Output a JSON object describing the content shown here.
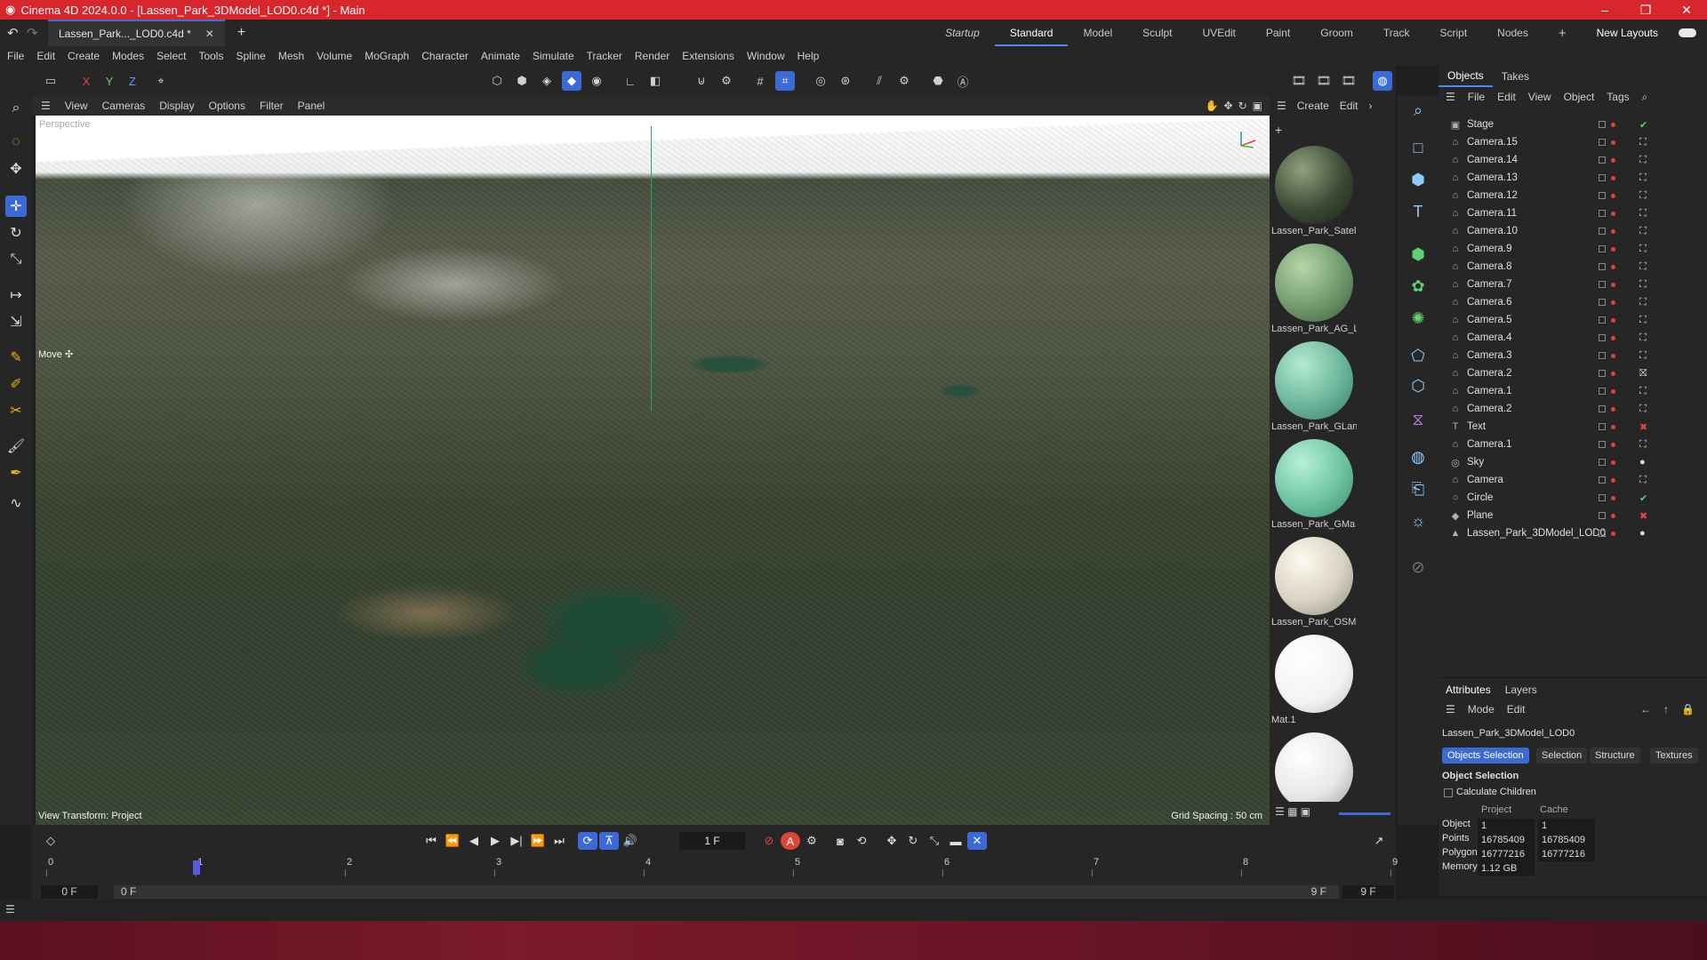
{
  "window": {
    "title": "Cinema 4D 2024.0.0 - [Lassen_Park_3DModel_LOD0.c4d *] - Main",
    "accent_color": "#d8262d"
  },
  "doc_tab": {
    "label": "Lassen_Park..._LOD0.c4d *"
  },
  "layouts": [
    "Startup",
    "Standard",
    "Model",
    "Sculpt",
    "UVEdit",
    "Paint",
    "Groom",
    "Track",
    "Script",
    "Nodes"
  ],
  "layouts_active": "Standard",
  "new_layouts": "New Layouts",
  "menu": [
    "File",
    "Edit",
    "Create",
    "Modes",
    "Select",
    "Tools",
    "Spline",
    "Mesh",
    "Volume",
    "MoGraph",
    "Character",
    "Animate",
    "Simulate",
    "Tracker",
    "Render",
    "Extensions",
    "Window",
    "Help"
  ],
  "toolbar": {
    "x": "X",
    "y": "Y",
    "z": "Z"
  },
  "viewport": {
    "menu": [
      "View",
      "Cameras",
      "Display",
      "Options",
      "Filter",
      "Panel"
    ],
    "camera_label": "Perspective",
    "move_label": "Move ✣",
    "view_transform": "View Transform: Project",
    "grid_spacing": "Grid Spacing : 50 cm"
  },
  "materials": {
    "menu": [
      "Create",
      "Edit"
    ],
    "items": [
      {
        "label": "Lassen_Park_Satel",
        "color": "#3b4a35"
      },
      {
        "label": "Lassen_Park_AG_L",
        "color": "#6f9a6c"
      },
      {
        "label": "Lassen_Park_GLan",
        "color": "#6ab69a"
      },
      {
        "label": "Lassen_Park_GMa",
        "color": "#6cc4a2"
      },
      {
        "label": "Lassen_Park_OSM",
        "color": "#d8d2c2"
      },
      {
        "label": "Mat.1",
        "color": "#f2f2f2"
      },
      {
        "label": "",
        "color": "#e8e8e8"
      }
    ]
  },
  "objects": {
    "tabs": [
      "Objects",
      "Takes"
    ],
    "menu": [
      "File",
      "Edit",
      "View",
      "Object",
      "Tags"
    ],
    "items": [
      {
        "name": "Stage",
        "icon": "▣",
        "tag": "✔"
      },
      {
        "name": "Camera.15",
        "icon": "⌂",
        "tag": "⛶"
      },
      {
        "name": "Camera.14",
        "icon": "⌂",
        "tag": "⛶"
      },
      {
        "name": "Camera.13",
        "icon": "⌂",
        "tag": "⛶"
      },
      {
        "name": "Camera.12",
        "icon": "⌂",
        "tag": "⛶"
      },
      {
        "name": "Camera.11",
        "icon": "⌂",
        "tag": "⛶"
      },
      {
        "name": "Camera.10",
        "icon": "⌂",
        "tag": "⛶"
      },
      {
        "name": "Camera.9",
        "icon": "⌂",
        "tag": "⛶"
      },
      {
        "name": "Camera.8",
        "icon": "⌂",
        "tag": "⛶"
      },
      {
        "name": "Camera.7",
        "icon": "⌂",
        "tag": "⛶"
      },
      {
        "name": "Camera.6",
        "icon": "⌂",
        "tag": "⛶"
      },
      {
        "name": "Camera.5",
        "icon": "⌂",
        "tag": "⛶"
      },
      {
        "name": "Camera.4",
        "icon": "⌂",
        "tag": "⛶"
      },
      {
        "name": "Camera.3",
        "icon": "⌂",
        "tag": "⛶"
      },
      {
        "name": "Camera.2",
        "icon": "⌂",
        "tag": "⛝"
      },
      {
        "name": "Camera.1",
        "icon": "⌂",
        "tag": "⛶"
      },
      {
        "name": "Camera.2",
        "icon": "⌂",
        "tag": "⛶"
      },
      {
        "name": "Text",
        "icon": "T",
        "tag": "✖"
      },
      {
        "name": "Camera.1",
        "icon": "⌂",
        "tag": "⛶"
      },
      {
        "name": "Sky",
        "icon": "◎",
        "tag": "●"
      },
      {
        "name": "Camera",
        "icon": "⌂",
        "tag": "⛶"
      },
      {
        "name": "Circle",
        "icon": "○",
        "tag": "✔"
      },
      {
        "name": "Plane",
        "icon": "◆",
        "tag": "✖"
      },
      {
        "name": "Lassen_Park_3DModel_LOD0",
        "icon": "▲",
        "tag": "●"
      }
    ]
  },
  "attributes": {
    "tabs": [
      "Attributes",
      "Layers"
    ],
    "menu": [
      "Mode",
      "Edit"
    ],
    "object_name": "Lassen_Park_3DModel_LOD0",
    "pills": [
      "Objects Selection",
      "Selection",
      "Structure",
      "Textures"
    ],
    "section": "Object Selection",
    "calc_children": "Calculate Children",
    "col_project": "Project",
    "col_cache": "Cache",
    "rows": [
      {
        "label": "Object",
        "project": "1",
        "cache": "1"
      },
      {
        "label": "Points",
        "project": "16785409",
        "cache": "16785409"
      },
      {
        "label": "Polygons",
        "project": "16777216",
        "cache": "16777216"
      },
      {
        "label": "Memory",
        "project": "1.12 GB",
        "cache": ""
      }
    ]
  },
  "transport": {
    "frame": "1 F"
  },
  "timeline": {
    "ticks": [
      "0",
      "1",
      "2",
      "3",
      "4",
      "5",
      "6",
      "7",
      "8",
      "9"
    ],
    "start": "0 F",
    "start2": "0 F",
    "end": "9 F",
    "end2": "9 F"
  }
}
